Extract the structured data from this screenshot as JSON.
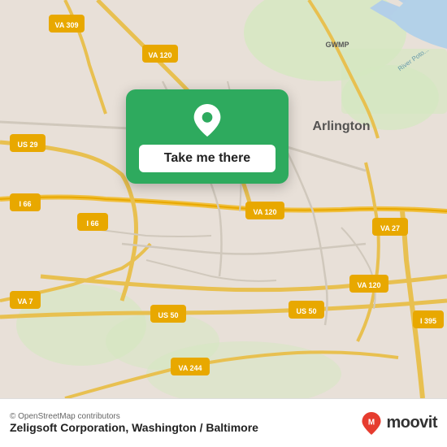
{
  "map": {
    "bg_color": "#e8e0d8",
    "center_label": "Arlington",
    "road_labels": [
      "VA 309",
      "VA 120",
      "US 29",
      "I 66",
      "VA 7",
      "US 50",
      "VA 244",
      "VA 27",
      "VA 120",
      "I 395",
      "US 50",
      "VA 120",
      "GWMP"
    ],
    "water_color": "#b3d1e8"
  },
  "card": {
    "bg_color": "#2eaa5e",
    "button_label": "Take me there",
    "pin_color": "white"
  },
  "bottom_bar": {
    "attribution": "© OpenStreetMap contributors",
    "location_text": "Zeligsoft Corporation, Washington / Baltimore",
    "moovit_text": "moovit",
    "moovit_logo_color": "#e63c2f"
  }
}
